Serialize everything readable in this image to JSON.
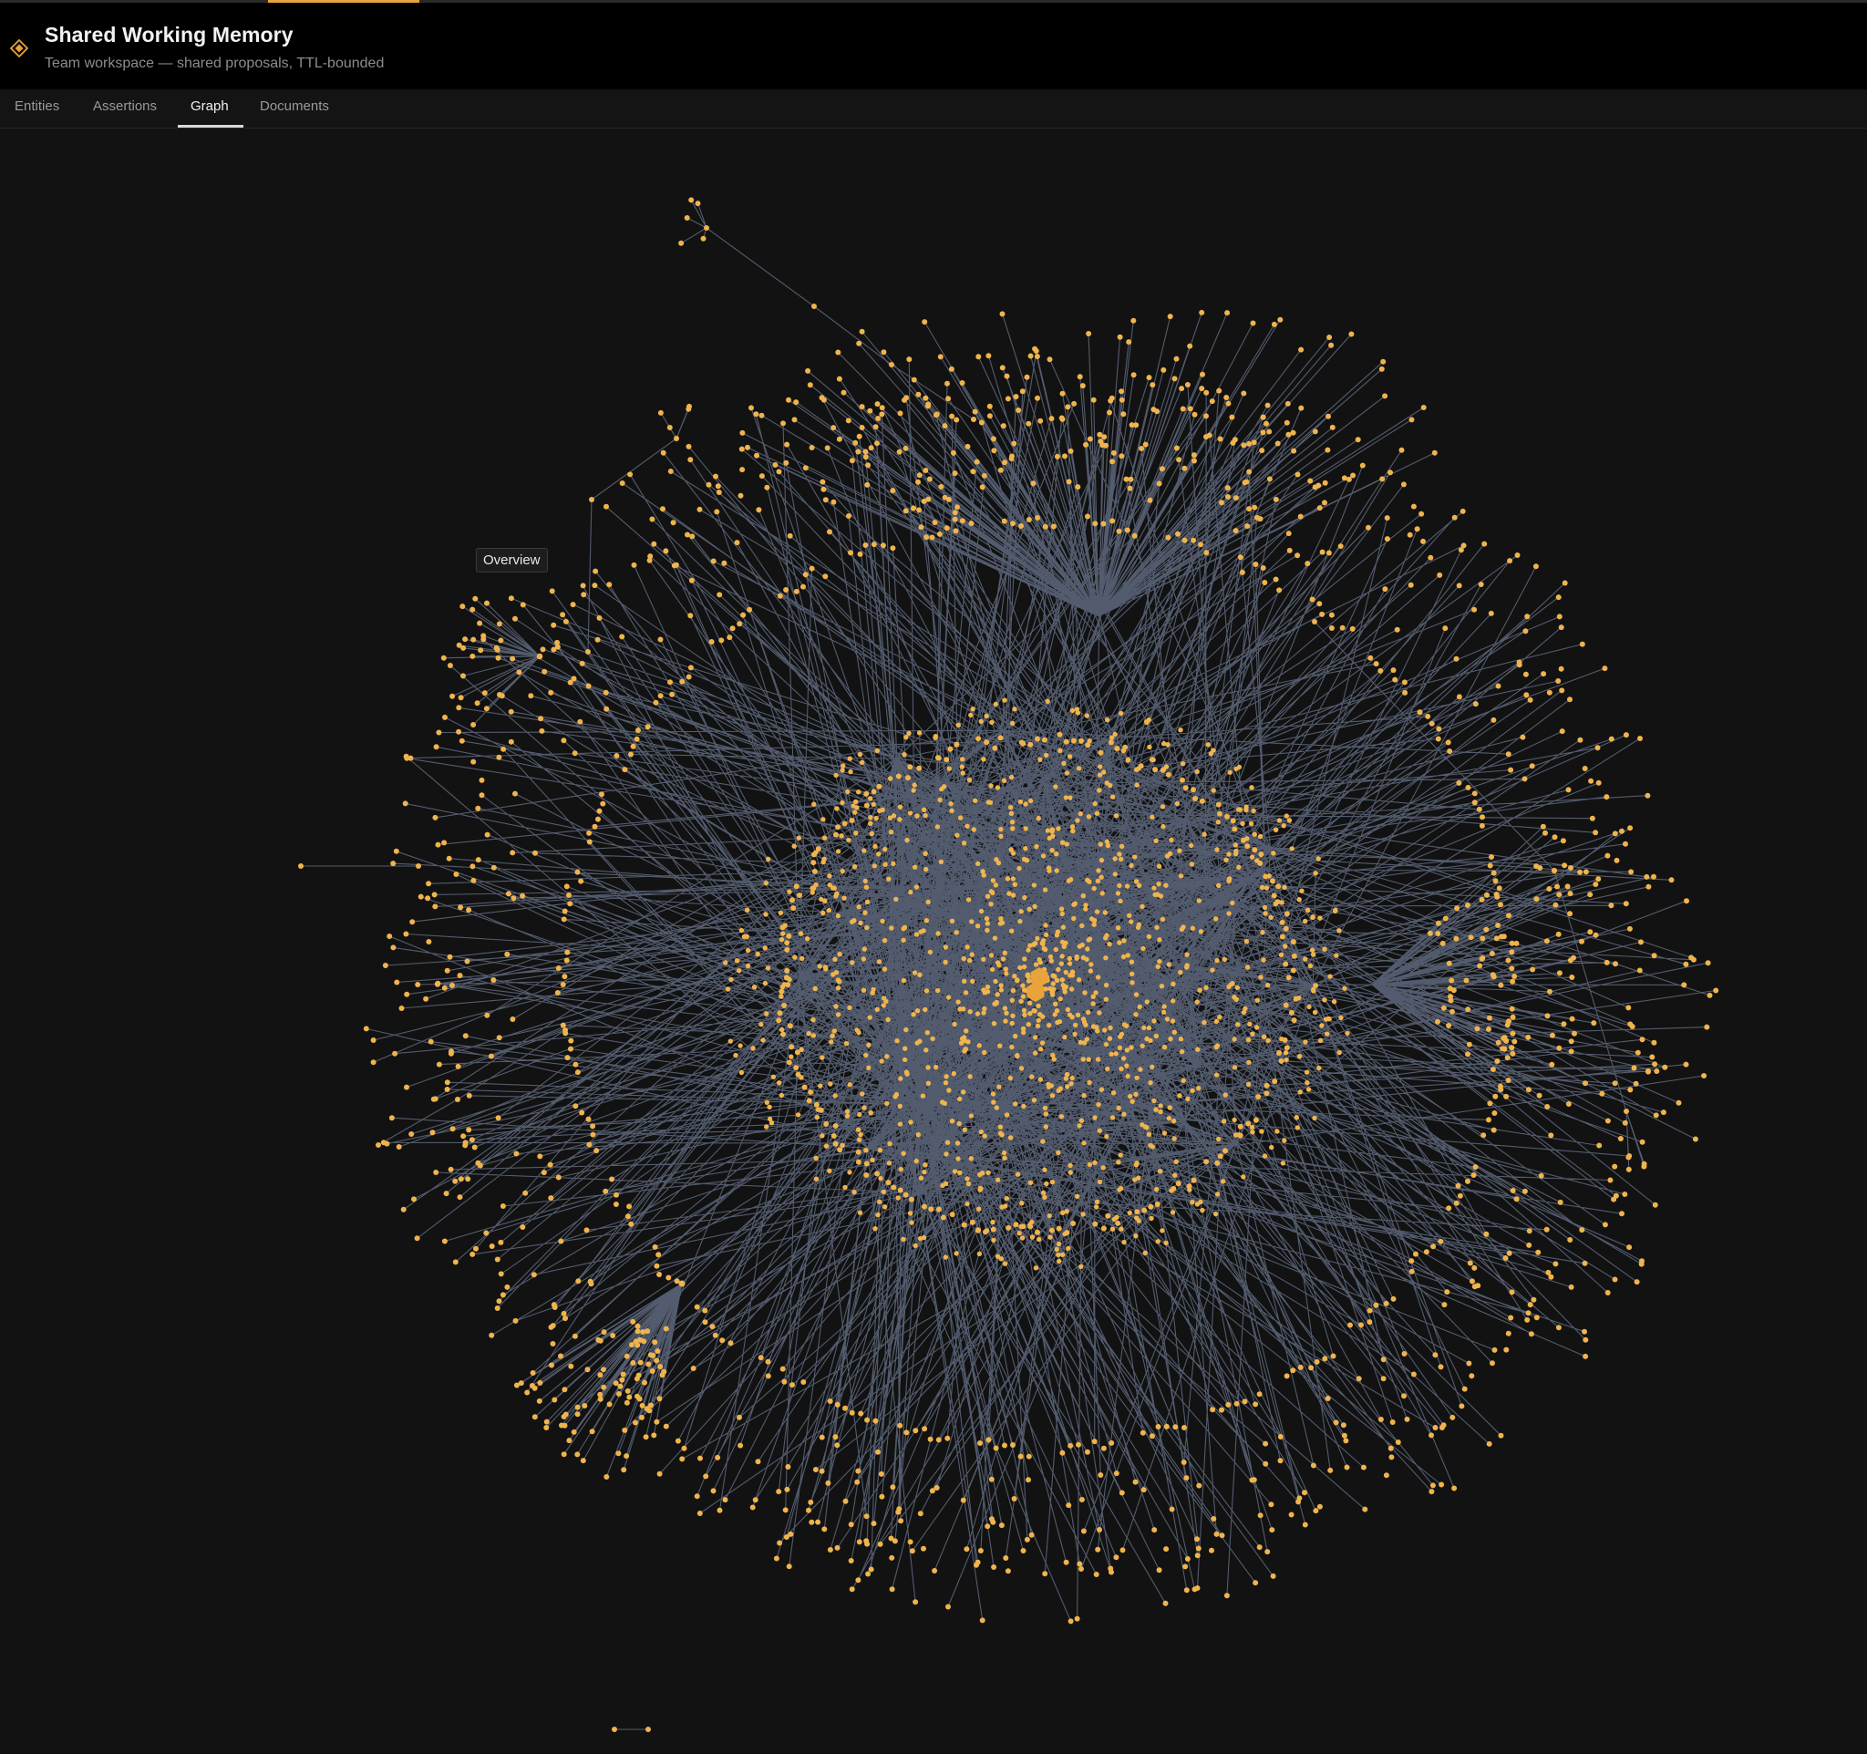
{
  "app": {
    "title": "Shared Working Memory",
    "subtitle": "Team workspace — shared proposals, TTL-bounded",
    "icon": "diamond-icon"
  },
  "tabs": [
    {
      "label": "Entities",
      "active": false
    },
    {
      "label": "Assertions",
      "active": false
    },
    {
      "label": "Graph",
      "active": true
    },
    {
      "label": "Documents",
      "active": false
    }
  ],
  "graph": {
    "tooltip": "Overview",
    "node_color": "#f0b44e",
    "edge_color": "#6c7891",
    "hub_color": "#e8a33a",
    "background": "#121212"
  },
  "colors": {
    "accent": "#e8a33a",
    "header_bg": "#000000",
    "body_bg": "#121212"
  }
}
